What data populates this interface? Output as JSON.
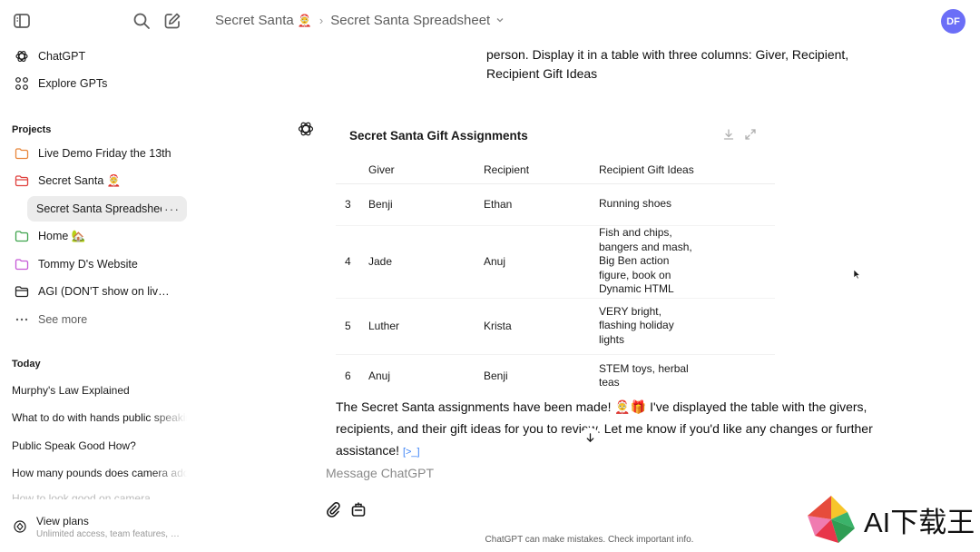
{
  "sidebar": {
    "nav": [
      {
        "label": "ChatGPT",
        "icon": "openai-logo-icon"
      },
      {
        "label": "Explore GPTs",
        "icon": "grid-icon"
      }
    ],
    "projects_label": "Projects",
    "projects": [
      {
        "label": "Live Demo Friday the 13th",
        "icon": "folder-icon",
        "color": "#e8863a"
      },
      {
        "label": "Secret Santa 🤶",
        "icon": "folder-icon",
        "color": "#e0413e"
      },
      {
        "label": "Secret Santa Spreadsheet",
        "icon": "",
        "active": true
      },
      {
        "label": "Home 🏡",
        "icon": "folder-icon",
        "color": "#3fa34d"
      },
      {
        "label": "Tommy D's Website",
        "icon": "folder-icon",
        "color": "#c659d6"
      },
      {
        "label": "AGI (DON'T show on livestream)",
        "icon": "folder-icon",
        "color": "#222222"
      },
      {
        "label": "See more",
        "icon": "ellipsis-icon"
      }
    ],
    "more_label": "···",
    "today_label": "Today",
    "chats": [
      "Murphy's Law Explained",
      "What to do with hands public speaking",
      "Public Speak Good How?",
      "How many pounds does camera add"
    ],
    "faded_chat": "How to look good on camera",
    "view_plans": {
      "title": "View plans",
      "subtitle": "Unlimited access, team features, and more"
    }
  },
  "header": {
    "project": "Secret Santa",
    "project_emoji": "🤶",
    "chat_title": "Secret Santa Spreadsheet",
    "avatar_initials": "DF",
    "avatar_color": "#6b6ef7"
  },
  "conversation": {
    "user_message_tail": "person. Display it in a table with three columns: Giver, Recipient, Recipient Gift Ideas",
    "table": {
      "title": "Secret Santa Gift Assignments",
      "columns": [
        "",
        "Giver",
        "Recipient",
        "Recipient Gift Ideas"
      ],
      "rows": [
        {
          "idx": "3",
          "giver": "Benji",
          "recipient": "Ethan",
          "ideas": "Running shoes"
        },
        {
          "idx": "4",
          "giver": "Jade",
          "recipient": "Anuj",
          "ideas": "Fish and chips, bangers and mash, Big Ben action figure, book on Dynamic HTML"
        },
        {
          "idx": "5",
          "giver": "Luther",
          "recipient": "Krista",
          "ideas": "VERY bright, flashing holiday lights"
        },
        {
          "idx": "6",
          "giver": "Anuj",
          "recipient": "Benji",
          "ideas": "STEM toys, herbal teas"
        }
      ]
    },
    "assistant_message": "The Secret Santa assignments have been made! 🤶🎁 I've displayed the table with the givers, recipients, and their gift ideas for you to review. Let me know if you'd like any changes or further assistance!",
    "source_marker": "[>_]"
  },
  "composer": {
    "placeholder": "Message ChatGPT"
  },
  "footer": {
    "disclaimer": "ChatGPT can make mistakes. Check important info."
  },
  "watermark": {
    "text": "AI下载王"
  }
}
